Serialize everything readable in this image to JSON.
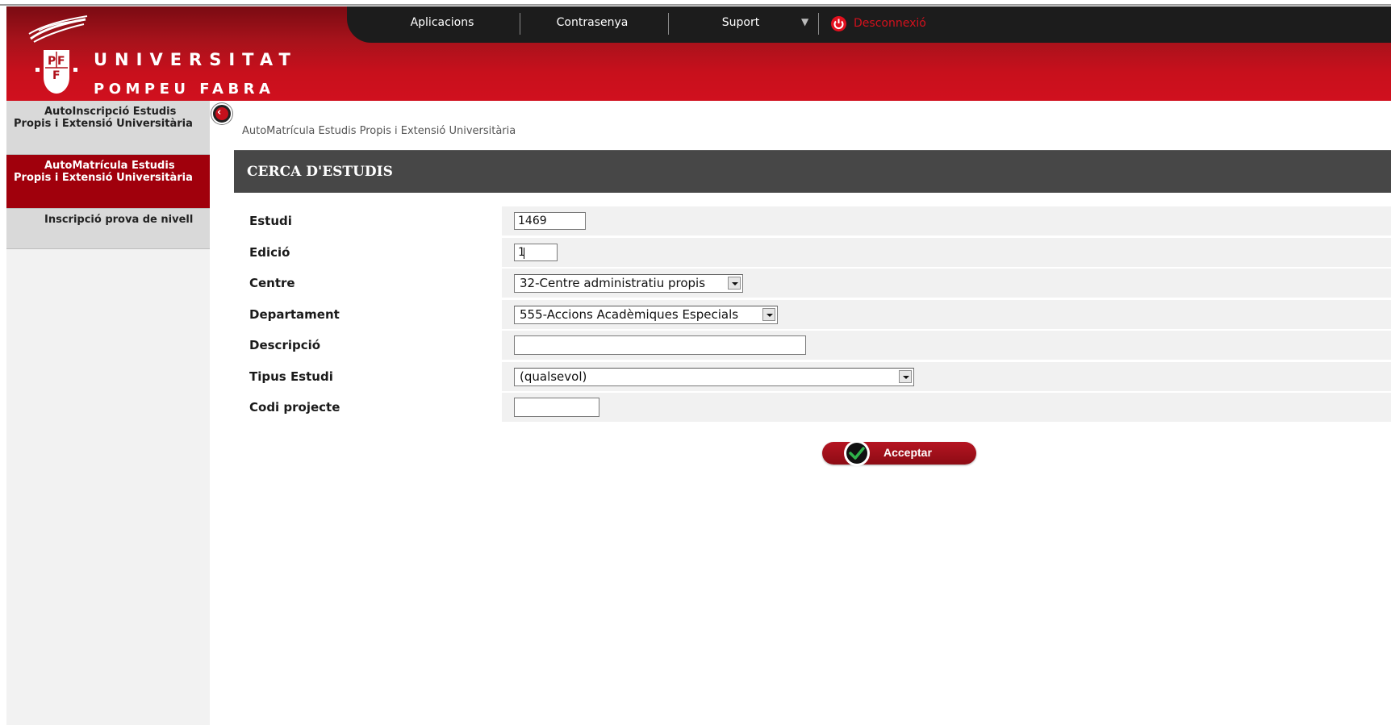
{
  "header": {
    "logo": {
      "line1": "UNIVERSITAT",
      "line2": "POMPEU FABRA"
    },
    "nav": [
      {
        "label": "Aplicacions"
      },
      {
        "label": "Contrasenya"
      },
      {
        "label": "Suport"
      }
    ],
    "logout_label": "Desconnexió"
  },
  "sidebar": {
    "items": [
      {
        "label": "AutoInscripció Estudis Propis i Extensió Universitària",
        "active": false
      },
      {
        "label": "AutoMatrícula Estudis Propis i Extensió Universitària",
        "active": true
      },
      {
        "label": "Inscripció prova de nivell",
        "active": false
      }
    ]
  },
  "breadcrumb": "AutoMatrícula Estudis Propis i Extensió Universitària",
  "section_title": "CERCA D'ESTUDIS",
  "form": {
    "estudi": {
      "label": "Estudi",
      "value": "1469"
    },
    "edicio": {
      "label": "Edició",
      "value": "1"
    },
    "centre": {
      "label": "Centre",
      "selected": "32-Centre administratiu propis"
    },
    "departament": {
      "label": "Departament",
      "selected": "555-Accions Acadèmiques Especials"
    },
    "descripcio": {
      "label": "Descripció",
      "value": ""
    },
    "tipus_estudi": {
      "label": "Tipus Estudi",
      "selected": "(qualsevol)"
    },
    "codi_projecte": {
      "label": "Codi projecte",
      "value": ""
    }
  },
  "accept_label": "Acceptar",
  "colors": {
    "brand_red": "#c8101c",
    "sidebar_active": "#a0000c",
    "nav_dark": "#1c1c1c",
    "section_bar": "#474747"
  }
}
